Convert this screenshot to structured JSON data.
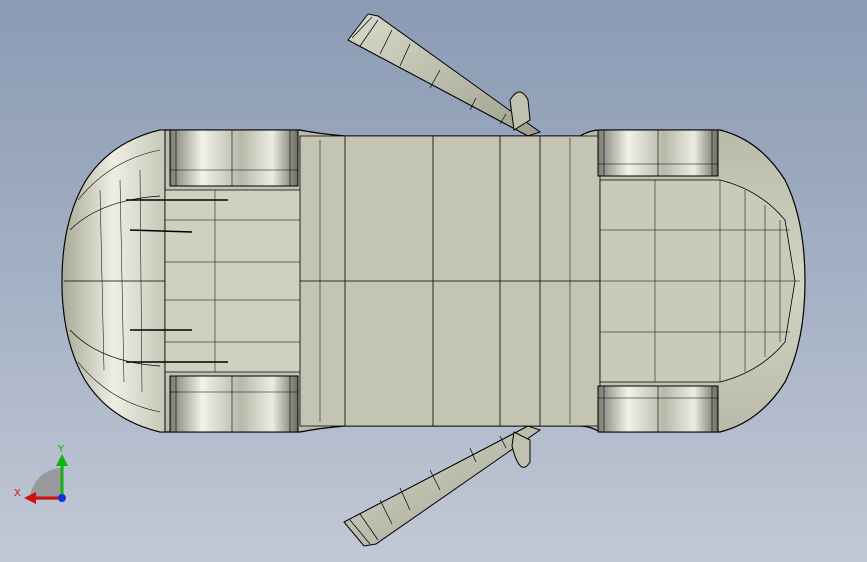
{
  "viewport": {
    "background_top": "#8a9bb4",
    "background_bottom": "#c2c8d5"
  },
  "model": {
    "body_color": "#c8c9b8",
    "edge_color": "#000000",
    "wheel_color": "#d8d8cc"
  },
  "triad": {
    "x_label": "X",
    "y_label": "Y",
    "x_color": "#d01010",
    "y_color": "#10b010",
    "z_color": "#1030e0"
  }
}
